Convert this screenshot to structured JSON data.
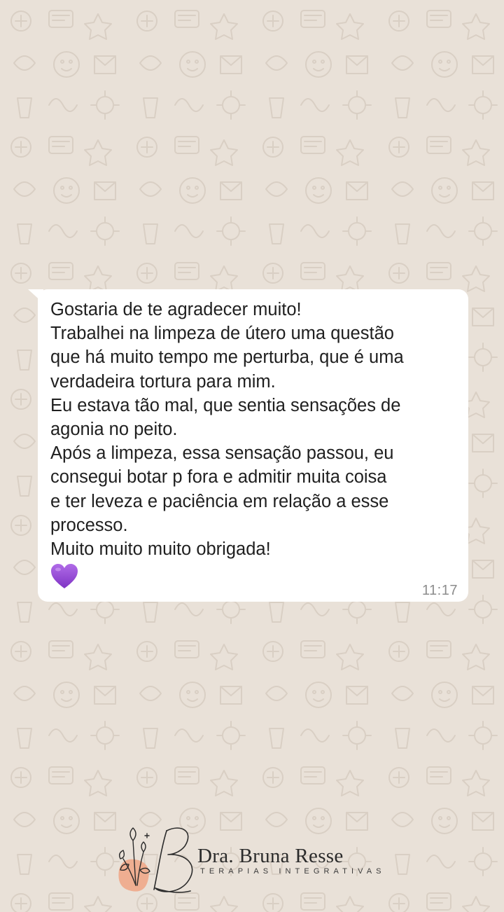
{
  "chat": {
    "message_lines": [
      "Gostaria de te agradecer muito!",
      "Trabalhei na limpeza de útero uma questão",
      "que há muito tempo me perturba, que é uma",
      "verdadeira tortura para mim.",
      "Eu estava tão mal, que sentia sensações de",
      "agonia no peito.",
      "Após a limpeza, essa sensação passou, eu",
      "consegui botar p fora e admitir muita coisa",
      "e ter leveza e paciência em relação a esse",
      "processo.",
      "Muito muito muito obrigada!"
    ],
    "emoji": "purple-heart",
    "time": "11:17"
  },
  "brand": {
    "name": "Dra. Bruna Resse",
    "tagline": "TERAPIAS INTEGRATIVAS",
    "accent_color": "#f0a98a"
  },
  "colors": {
    "wallpaper": "#e9e1d8",
    "bubble": "#ffffff",
    "heart": "#9b4fd6"
  }
}
